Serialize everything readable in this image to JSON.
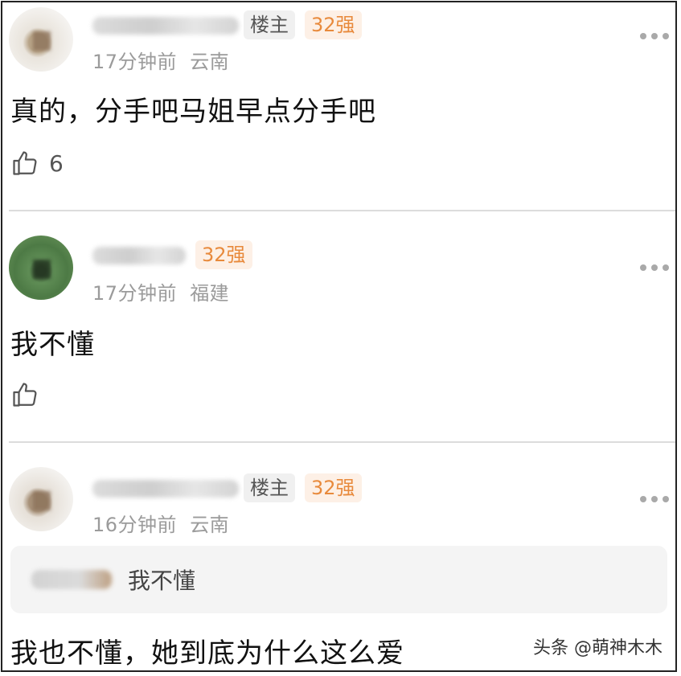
{
  "comments": [
    {
      "owner_badge": "楼主",
      "rank_badge": "32强",
      "time": "17分钟前",
      "location": "云南",
      "content": "真的，分手吧马姐早点分手吧",
      "likes": "6"
    },
    {
      "rank_badge": "32强",
      "time": "17分钟前",
      "location": "福建",
      "content": "我不懂",
      "likes": ""
    },
    {
      "owner_badge": "楼主",
      "rank_badge": "32强",
      "time": "16分钟前",
      "location": "云南",
      "quoted_text": "我不懂",
      "content": "我也不懂，她到底为什么这么爱"
    }
  ],
  "watermark": "头条 @萌神木木",
  "icons": {
    "like": "thumbs-up-icon",
    "more": "more-dots-icon"
  },
  "colors": {
    "rank_badge_text": "#e88a3c",
    "rank_badge_bg": "#fdf0e6",
    "meta_text": "#9b9b9b"
  }
}
